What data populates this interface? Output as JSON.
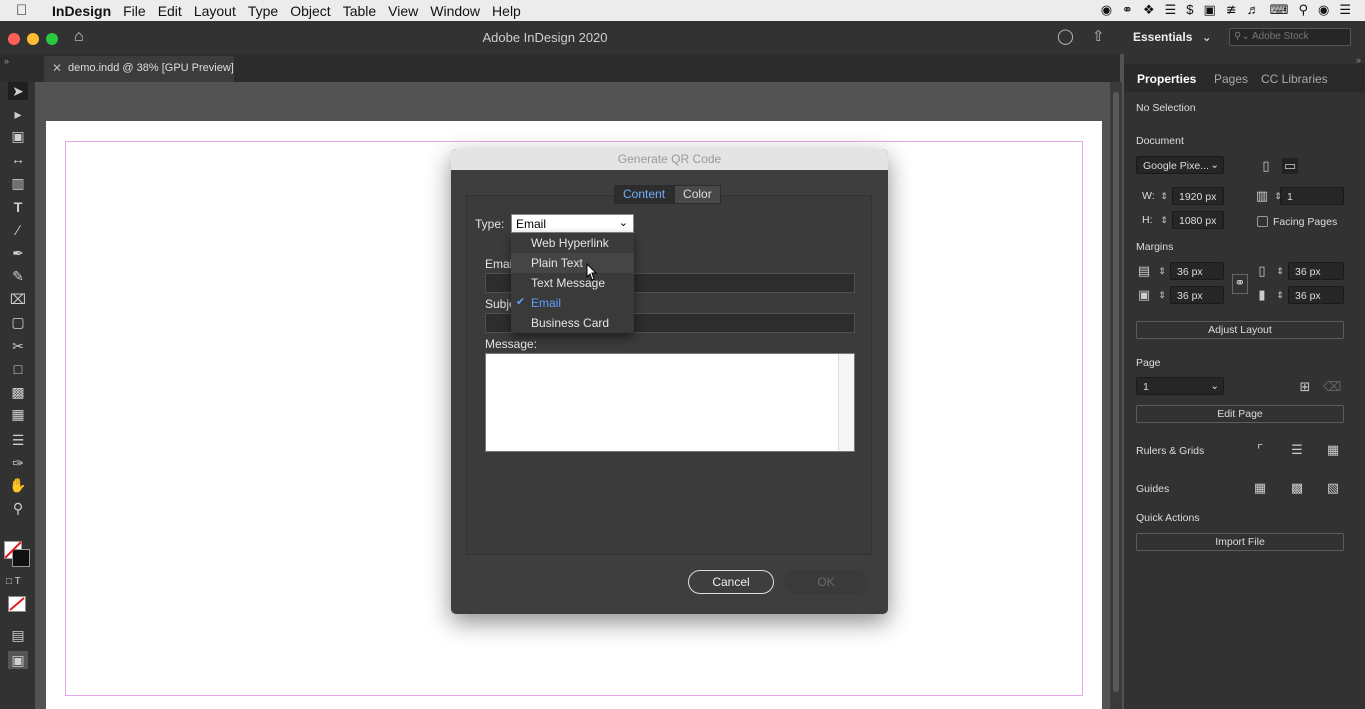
{
  "menubar": {
    "app": "InDesign",
    "items": [
      "File",
      "Edit",
      "Layout",
      "Type",
      "Object",
      "Table",
      "View",
      "Window",
      "Help"
    ]
  },
  "window": {
    "title": "Adobe InDesign 2020",
    "workspace": "Essentials",
    "search_placeholder": "Adobe Stock",
    "document_tab": "demo.indd @ 38% [GPU Preview]"
  },
  "panel": {
    "tabs": [
      "Properties",
      "Pages",
      "CC Libraries"
    ],
    "selection": "No Selection",
    "document_label": "Document",
    "preset": "Google Pixe...",
    "width_label": "W:",
    "width": "1920 px",
    "height_label": "H:",
    "height": "1080 px",
    "pages_count": "1",
    "facing_pages": "Facing Pages",
    "margins_label": "Margins",
    "margins": [
      "36 px",
      "36 px",
      "36 px",
      "36 px"
    ],
    "adjust_layout": "Adjust Layout",
    "page_label": "Page",
    "page_value": "1",
    "edit_page": "Edit Page",
    "rulers_grids": "Rulers & Grids",
    "guides": "Guides",
    "quick_actions": "Quick Actions",
    "import_file": "Import File"
  },
  "dialog": {
    "title": "Generate QR Code",
    "tabs": [
      "Content",
      "Color"
    ],
    "type_label": "Type:",
    "type_value": "Email",
    "email_label": "Emai",
    "subject_label": "Subje",
    "message_label": "Message:",
    "cancel": "Cancel",
    "ok": "OK",
    "options": [
      "Web Hyperlink",
      "Plain Text",
      "Text Message",
      "Email",
      "Business Card"
    ],
    "selected_option": "Email"
  },
  "colors": {
    "accent": "#5aa2ff",
    "margin_guide": "#e9a7e9",
    "traffic_red": "#fe5f57",
    "traffic_yellow": "#febc2e",
    "traffic_green": "#28c840"
  }
}
